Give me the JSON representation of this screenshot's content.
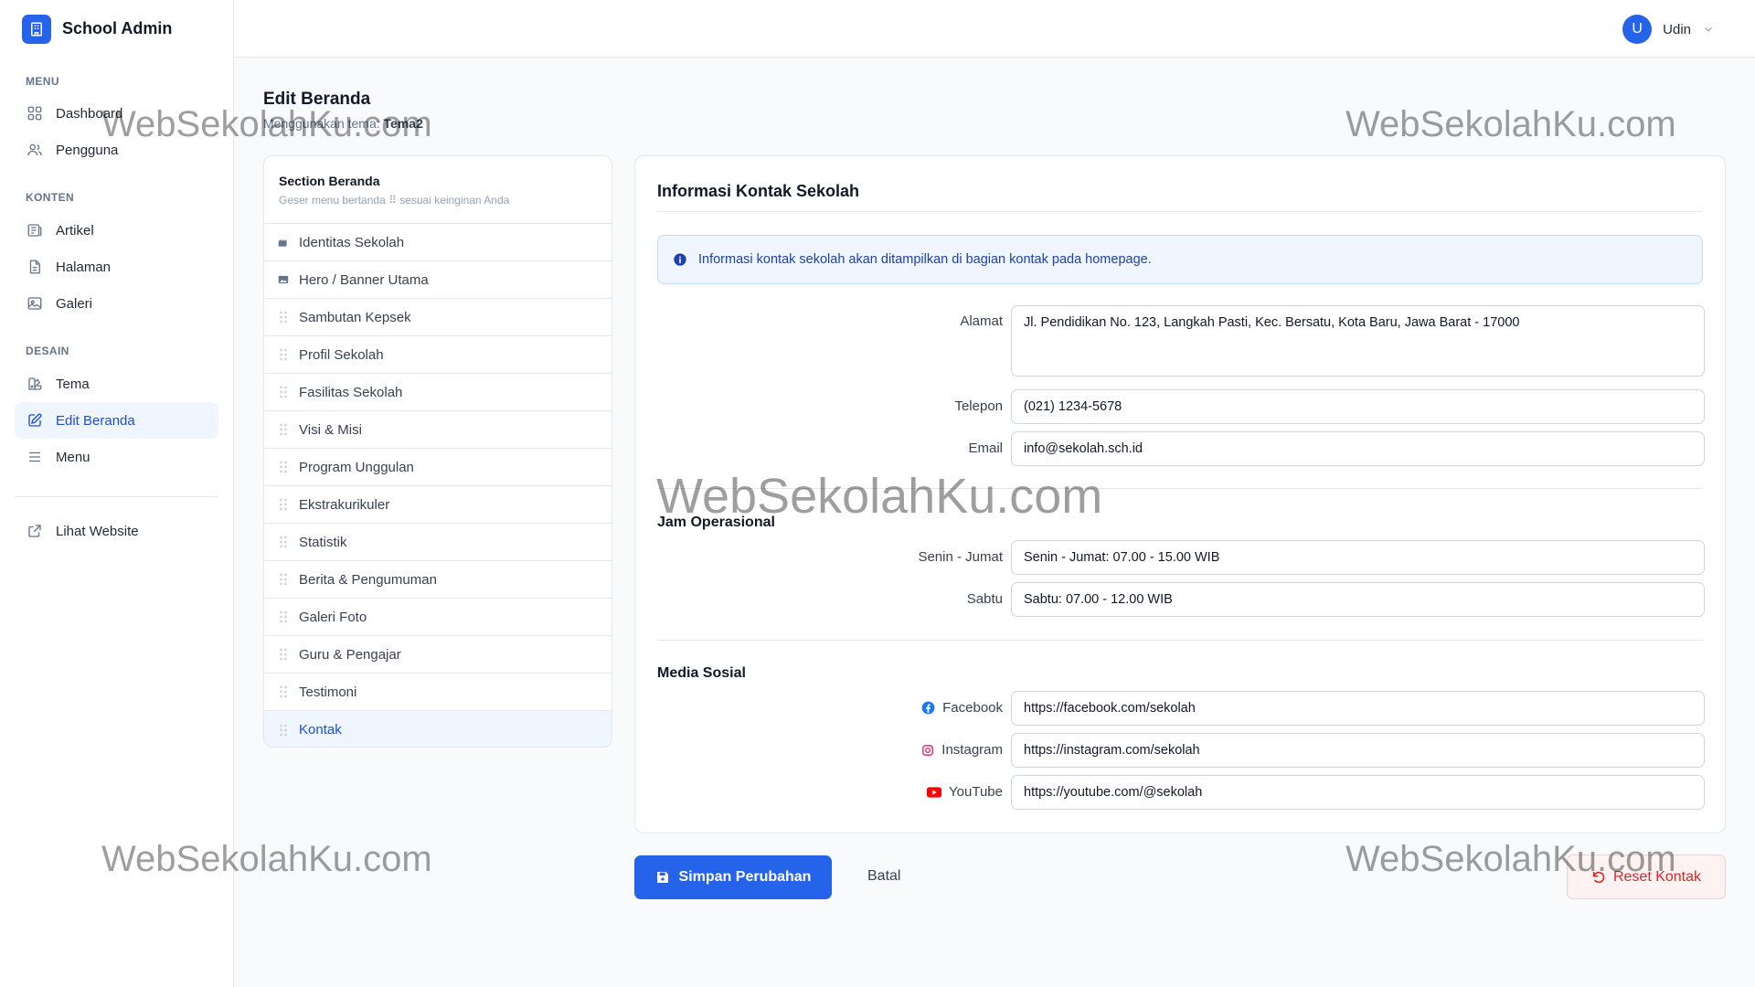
{
  "brand": {
    "title": "School Admin"
  },
  "sidebar": {
    "sections": [
      "MENU",
      "KONTEN",
      "DESAIN"
    ],
    "items": [
      {
        "label": "Dashboard",
        "icon": "grid-icon"
      },
      {
        "label": "Pengguna",
        "icon": "users-icon"
      },
      {
        "label": "Artikel",
        "icon": "newspaper-icon"
      },
      {
        "label": "Halaman",
        "icon": "document-icon"
      },
      {
        "label": "Galeri",
        "icon": "photo-icon"
      },
      {
        "label": "Tema",
        "icon": "palette-icon"
      },
      {
        "label": "Edit Beranda",
        "icon": "edit-icon",
        "active": true
      },
      {
        "label": "Menu",
        "icon": "bars-icon"
      },
      {
        "label": "Lihat Website",
        "icon": "external-link-icon"
      }
    ]
  },
  "header": {
    "user_initial": "U",
    "user_name": "Udin"
  },
  "page": {
    "title": "Edit Beranda",
    "subtitle_prefix": "Menggunakan tema:",
    "theme": "Tema2"
  },
  "sections_panel": {
    "title": "Section Beranda",
    "hint": "Geser menu bertanda ⠿ sesuai keinginan Anda",
    "items": [
      "Identitas Sekolah",
      "Hero / Banner Utama",
      "Sambutan Kepsek",
      "Profil Sekolah",
      "Fasilitas Sekolah",
      "Visi & Misi",
      "Program Unggulan",
      "Ekstrakurikuler",
      "Statistik",
      "Berita & Pengumuman",
      "Galeri Foto",
      "Guru & Pengajar",
      "Testimoni",
      "Kontak"
    ],
    "active_item": "Kontak"
  },
  "form": {
    "title": "Informasi Kontak Sekolah",
    "alert": "Informasi kontak sekolah akan ditampilkan di bagian kontak pada homepage.",
    "alamat": {
      "label": "Alamat",
      "value": "Jl. Pendidikan No. 123, Langkah Pasti, Kec. Bersatu, Kota Baru, Jawa Barat - 17000"
    },
    "telepon": {
      "label": "Telepon",
      "value": "(021) 1234-5678"
    },
    "email": {
      "label": "Email",
      "value": "info@sekolah.sch.id"
    },
    "jam_title": "Jam Operasional",
    "senin": {
      "label": "Senin - Jumat",
      "value": "Senin - Jumat: 07.00 - 15.00 WIB"
    },
    "sabtu": {
      "label": "Sabtu",
      "value": "Sabtu: 07.00 - 12.00 WIB"
    },
    "sosial_title": "Media Sosial",
    "facebook": {
      "label": "Facebook",
      "value": "https://facebook.com/sekolah"
    },
    "instagram": {
      "label": "Instagram",
      "value": "https://instagram.com/sekolah"
    },
    "youtube": {
      "label": "YouTube",
      "value": "https://youtube.com/@sekolah"
    }
  },
  "actions": {
    "save": "Simpan Perubahan",
    "cancel": "Batal",
    "reset": "Reset Kontak"
  },
  "watermark": "WebSekolahKu.com",
  "colors": {
    "primary": "#2563eb",
    "active_bg": "#eff6ff",
    "danger": "#dc2626",
    "facebook": "#1877f2",
    "instagram": "#e1306c",
    "youtube": "#ff0000"
  }
}
